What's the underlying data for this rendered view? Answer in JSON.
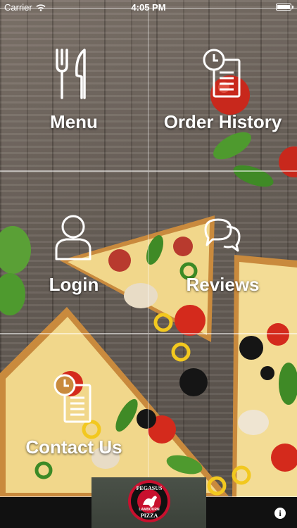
{
  "status_bar": {
    "carrier": "Carrier",
    "time": "4:05 PM"
  },
  "tiles": [
    {
      "label": "Menu",
      "icon": "fork-knife-icon"
    },
    {
      "label": "Order History",
      "icon": "clock-document-icon"
    },
    {
      "label": "Login",
      "icon": "user-icon"
    },
    {
      "label": "Reviews",
      "icon": "chat-bubbles-icon"
    },
    {
      "label": "Contact Us",
      "icon": "clock-document-icon"
    },
    {
      "label": "",
      "icon": ""
    }
  ],
  "logo": {
    "top_text": "PEGASUS",
    "middle_text": "LAMBOURN",
    "bottom_text": "PIZZA",
    "colors": {
      "ring": "#111111",
      "accent": "#c8102e",
      "text": "#ffffff"
    }
  },
  "info_button": {
    "icon": "info-icon",
    "glyph": "i"
  },
  "colors": {
    "wood": "#6b625a",
    "tile_border": "#ffffff",
    "bottom_bar": "#111111",
    "tomato": "#d42a1c",
    "basil": "#4e9a2e",
    "cheese": "#f1d78b",
    "crust": "#c98a3d"
  }
}
